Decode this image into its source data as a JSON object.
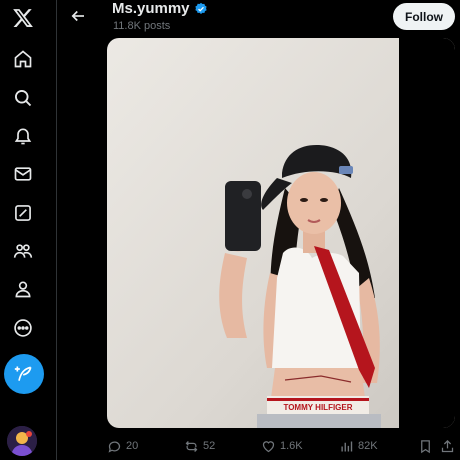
{
  "nav": {
    "items": [
      "x-logo",
      "home-icon",
      "search-icon",
      "notifications-icon",
      "messages-icon",
      "grok-icon",
      "communities-icon",
      "profile-icon",
      "more-icon"
    ],
    "compose_icon": "feather-plus-icon"
  },
  "header": {
    "name": "Ms.yummy",
    "posts": "11.8K posts",
    "follow_label": "Follow",
    "verified_color": "#1d9bf0"
  },
  "media": {
    "waistband_text": "TOMMY HILFIGER"
  },
  "actions": {
    "replies": "20",
    "reposts": "52",
    "likes": "1.6K",
    "views": "82K"
  },
  "colors": {
    "background": "#000000",
    "text": "#e7e9ea",
    "muted": "#71767b",
    "accent": "#1d9bf0"
  }
}
